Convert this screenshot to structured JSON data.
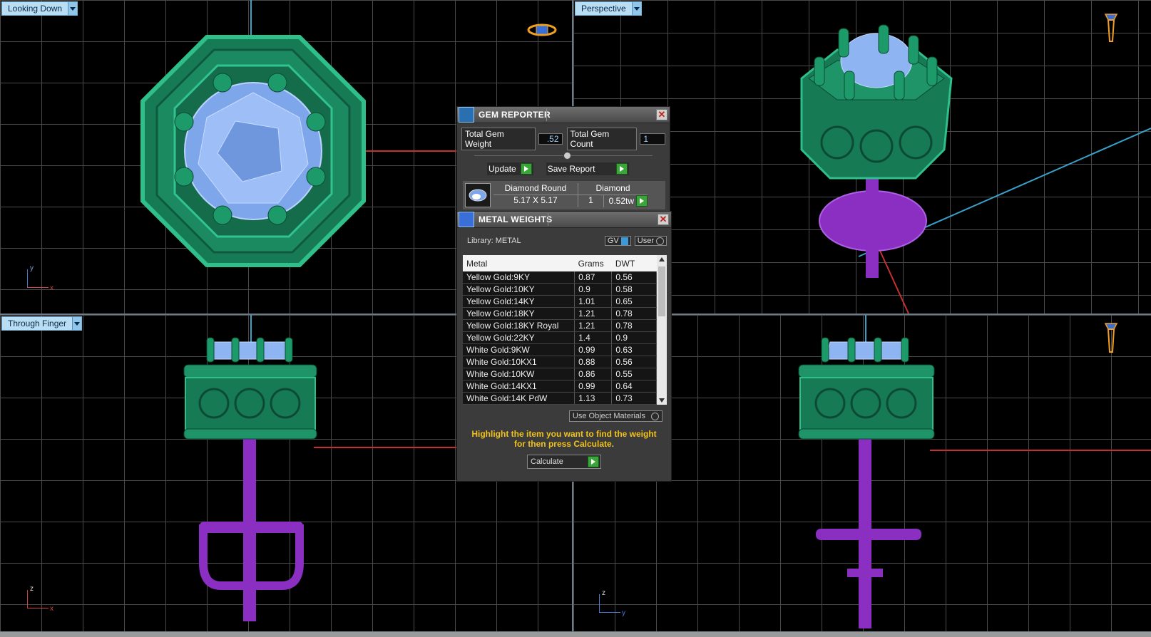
{
  "viewports": {
    "top_left": {
      "label": "Looking Down",
      "axis_v": "y",
      "axis_h": "x"
    },
    "top_right": {
      "label": "Perspective"
    },
    "bottom_left": {
      "label": "Through Finger",
      "axis_v": "z",
      "axis_h": "x"
    },
    "bottom_right": {
      "label": "",
      "axis_v": "z",
      "axis_h": "y"
    }
  },
  "gem_reporter": {
    "title": "GEM REPORTER",
    "total_weight_label": "Total Gem Weight",
    "total_weight_value": ".52",
    "total_count_label": "Total Gem Count",
    "total_count_value": "1",
    "update_label": "Update",
    "save_label": "Save Report",
    "gem": {
      "shape": "Diamond Round",
      "size": "5.17 X 5.17",
      "material": "Diamond",
      "count": "1",
      "weight": "0.52tw"
    }
  },
  "metal_weights": {
    "title": "METAL WEIGHTS",
    "library_label": "Library: METAL",
    "gv_label": "GV",
    "user_label": "User",
    "columns": [
      "Metal",
      "Grams",
      "DWT"
    ],
    "rows": [
      {
        "metal": "Yellow Gold:9KY",
        "grams": "0.87",
        "dwt": "0.56"
      },
      {
        "metal": "Yellow Gold:10KY",
        "grams": "0.9",
        "dwt": "0.58"
      },
      {
        "metal": "Yellow Gold:14KY",
        "grams": "1.01",
        "dwt": "0.65"
      },
      {
        "metal": "Yellow Gold:18KY",
        "grams": "1.21",
        "dwt": "0.78"
      },
      {
        "metal": "Yellow Gold:18KY Royal",
        "grams": "1.21",
        "dwt": "0.78"
      },
      {
        "metal": "Yellow Gold:22KY",
        "grams": "1.4",
        "dwt": "0.9"
      },
      {
        "metal": "White Gold:9KW",
        "grams": "0.99",
        "dwt": "0.63"
      },
      {
        "metal": "White Gold:10KX1",
        "grams": "0.88",
        "dwt": "0.56"
      },
      {
        "metal": "White Gold:10KW",
        "grams": "0.86",
        "dwt": "0.55"
      },
      {
        "metal": "White Gold:14KX1",
        "grams": "0.99",
        "dwt": "0.64"
      },
      {
        "metal": "White Gold:14K PdW",
        "grams": "1.13",
        "dwt": "0.73"
      }
    ],
    "use_object_materials": "Use Object Materials",
    "instruction": "Highlight the item you want to find the weight for then press Calculate.",
    "calculate_label": "Calculate"
  },
  "colors": {
    "metal_green": "#1f8a63",
    "gem_blue": "#8fb4f2",
    "post_purple": "#8a2fc2",
    "tab_bg": "#b9ddf2",
    "instruction_yellow": "#f2c21a"
  }
}
